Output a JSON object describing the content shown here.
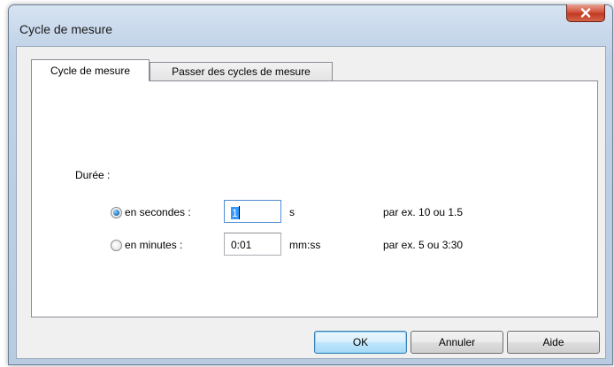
{
  "window": {
    "title": "Cycle de mesure"
  },
  "tabs": [
    {
      "label": "Cycle de mesure",
      "active": true
    },
    {
      "label": "Passer des cycles de mesure",
      "active": false
    }
  ],
  "duration": {
    "heading": "Durée :",
    "seconds": {
      "label": "en secondes :",
      "checked": true,
      "value": "1",
      "unit": "s",
      "example": "par ex. 10 ou 1.5"
    },
    "minutes": {
      "label": "en minutes :",
      "checked": false,
      "value": "0:01",
      "unit": "mm:ss",
      "example": "par ex. 5 ou 3:30"
    }
  },
  "buttons": {
    "ok": "OK",
    "cancel": "Annuler",
    "help": "Aide"
  },
  "colors": {
    "accent": "#3399ff",
    "close_button": "#c13a20"
  }
}
